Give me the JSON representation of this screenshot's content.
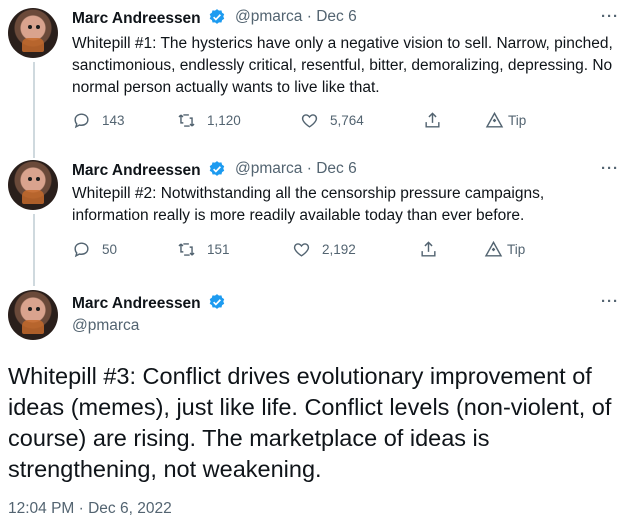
{
  "colors": {
    "verified": "#1d9bf0",
    "muted": "#536471",
    "text": "#0f1419",
    "line": "#cfd9de"
  },
  "author": {
    "name": "Marc Andreessen",
    "handle": "@pmarca"
  },
  "tweets": [
    {
      "date": "Dec 6",
      "text": "Whitepill #1: The hysterics have only a negative vision to sell. Narrow, pinched, sanctimonious, endlessly critical, resentful, bitter, demoralizing, depressing. No normal person actually wants to live like that.",
      "replies": "143",
      "retweets": "1,120",
      "likes": "5,764",
      "tip": "Tip"
    },
    {
      "date": "Dec 6",
      "text": "Whitepill #2: Notwithstanding all the censorship pressure campaigns, information really is more readily available today than ever before.",
      "replies": "50",
      "retweets": "151",
      "likes": "2,192",
      "tip": "Tip"
    }
  ],
  "main_tweet": {
    "text": "Whitepill #3: Conflict drives evolutionary improvement of ideas (memes), just like life. Conflict levels (non-violent, of course) are rising. The marketplace of ideas is strengthening, not weakening.",
    "timestamp": "12:04 PM · Dec 6, 2022"
  },
  "ui": {
    "separator": "·",
    "more": "···"
  }
}
